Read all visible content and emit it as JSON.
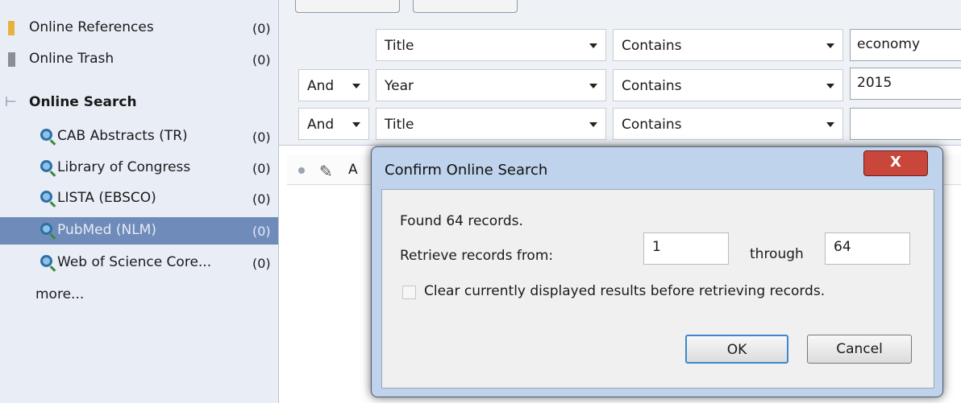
{
  "sidebar": {
    "items": [
      {
        "label": "Online References",
        "count": "(0)"
      },
      {
        "label": "Online Trash",
        "count": "(0)"
      },
      {
        "label": "Online Search",
        "count": ""
      },
      {
        "label": "CAB Abstracts (TR)",
        "count": "(0)"
      },
      {
        "label": "Library of Congress",
        "count": "(0)"
      },
      {
        "label": "LISTA (EBSCO)",
        "count": "(0)"
      },
      {
        "label": "PubMed (NLM)",
        "count": "(0)"
      },
      {
        "label": "Web of Science Core...",
        "count": "(0)"
      },
      {
        "label": "more...",
        "count": ""
      }
    ],
    "selected_index": 6
  },
  "search": {
    "rows": [
      {
        "bool": "",
        "field": "Title",
        "op": "Contains",
        "value": "economy"
      },
      {
        "bool": "And",
        "field": "Year",
        "op": "Contains",
        "value": "2015"
      },
      {
        "bool": "And",
        "field": "Title",
        "op": "Contains",
        "value": ""
      }
    ]
  },
  "results": {
    "header_letter": "A"
  },
  "dialog": {
    "title": "Confirm Online Search",
    "close_label": "X",
    "found_text": "Found 64 records.",
    "retrieve_label": "Retrieve records from:",
    "from_value": "1",
    "through_label": "through",
    "through_value": "64",
    "clear_label": "Clear currently displayed results before retrieving records.",
    "ok_label": "OK",
    "cancel_label": "Cancel"
  }
}
